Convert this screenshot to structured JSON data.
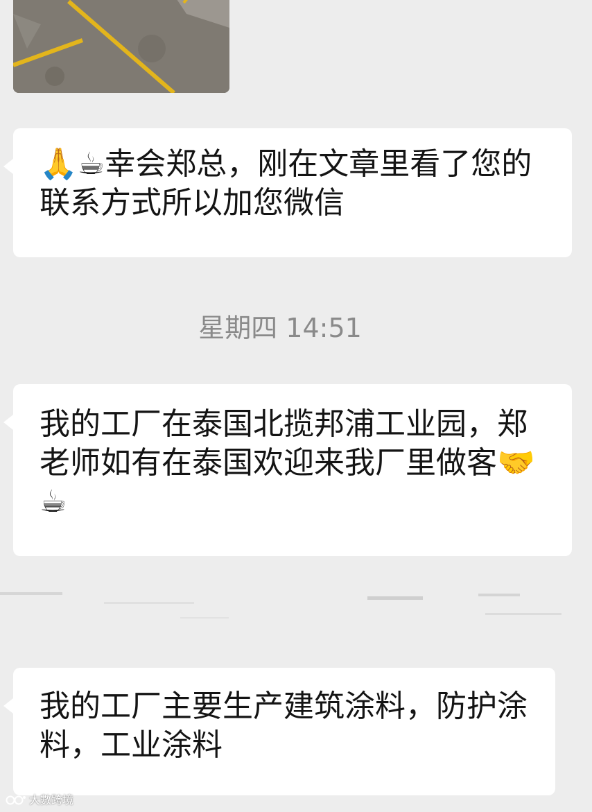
{
  "messages": [
    {
      "emoji_prefix": "🙏☕",
      "text": "幸会郑总，刚在文章里看了您的联系方式所以加您微信"
    },
    {
      "text": "我的工厂在泰国北揽邦浦工业园，郑老师如有在泰国欢迎来我厂里做客",
      "emoji_suffix": "🤝☕"
    },
    {
      "text": "我的工厂主要生产建筑涂料，防护涂料，工业涂料"
    }
  ],
  "timestamp": "星期四 14:51",
  "image_message": {
    "icon": "parking-lot-photo"
  },
  "watermark": {
    "text": "大數跨境"
  },
  "colors": {
    "background": "#ededed",
    "bubble": "#ffffff",
    "timestamp": "#8a8a8a",
    "text": "#141414"
  }
}
